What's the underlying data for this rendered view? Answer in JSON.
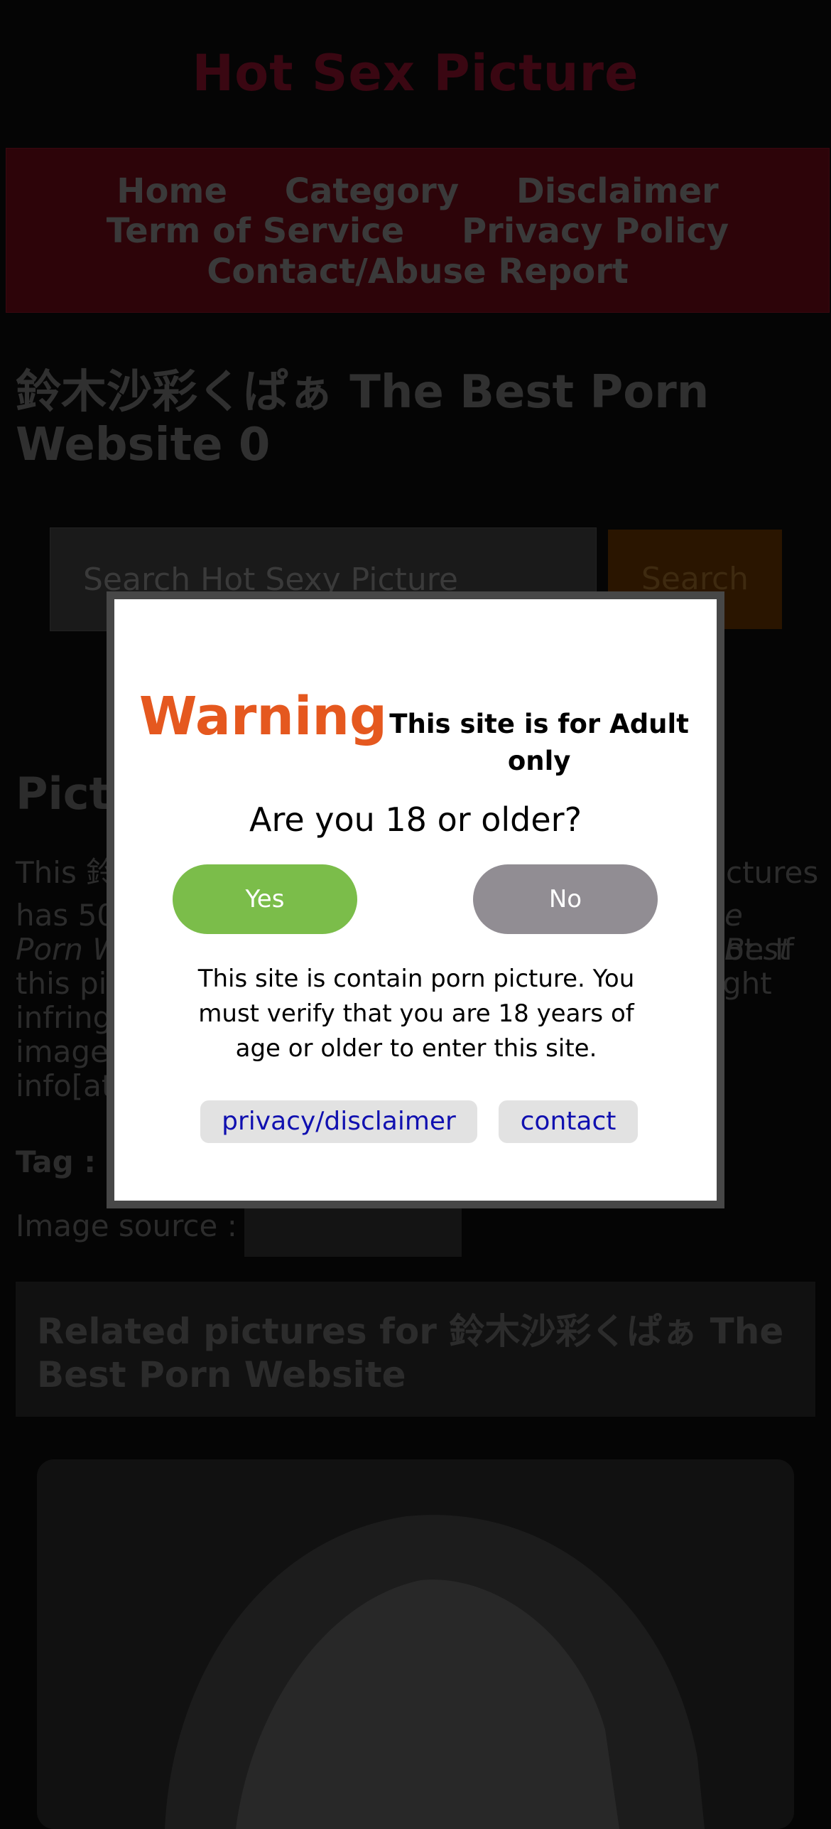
{
  "site": {
    "title": "Hot Sex Picture"
  },
  "nav": {
    "items": [
      "Home",
      "Category",
      "Disclaimer",
      "Term of Service",
      "Privacy Policy",
      "Contact/Abuse Report"
    ]
  },
  "page": {
    "title": "鈴木沙彩くぱぁ The Best Porn Website 0"
  },
  "search": {
    "placeholder": "Search Hot Sexy Picture",
    "button_label": "Search"
  },
  "content": {
    "heading_partial": "Pict",
    "text_fragments": [
      "This 鈴",
      "ctures",
      "has 50",
      "e Best",
      "Porn W",
      "ot. If",
      "this pi",
      "ght",
      "infring",
      "image",
      "info[at"
    ],
    "tag_label": "Tag :",
    "source_label": "Image source :"
  },
  "related": {
    "title": "Related pictures for 鈴木沙彩くぱぁ The Best Porn Website"
  },
  "modal": {
    "warning_word": "Warning",
    "warning_sub": "This site is for Adult only",
    "question": "Are you 18 or older?",
    "yes_label": "Yes",
    "no_label": "No",
    "notice": "This site is contain porn picture. You must verify that you are 18 years of age or older to enter this site.",
    "privacy_link": "privacy/disclaimer",
    "contact_link": "contact",
    "colors": {
      "warning": "#e5581f",
      "yes": "#7bbd4a",
      "no": "#918d93",
      "link": "#1010b0"
    }
  }
}
